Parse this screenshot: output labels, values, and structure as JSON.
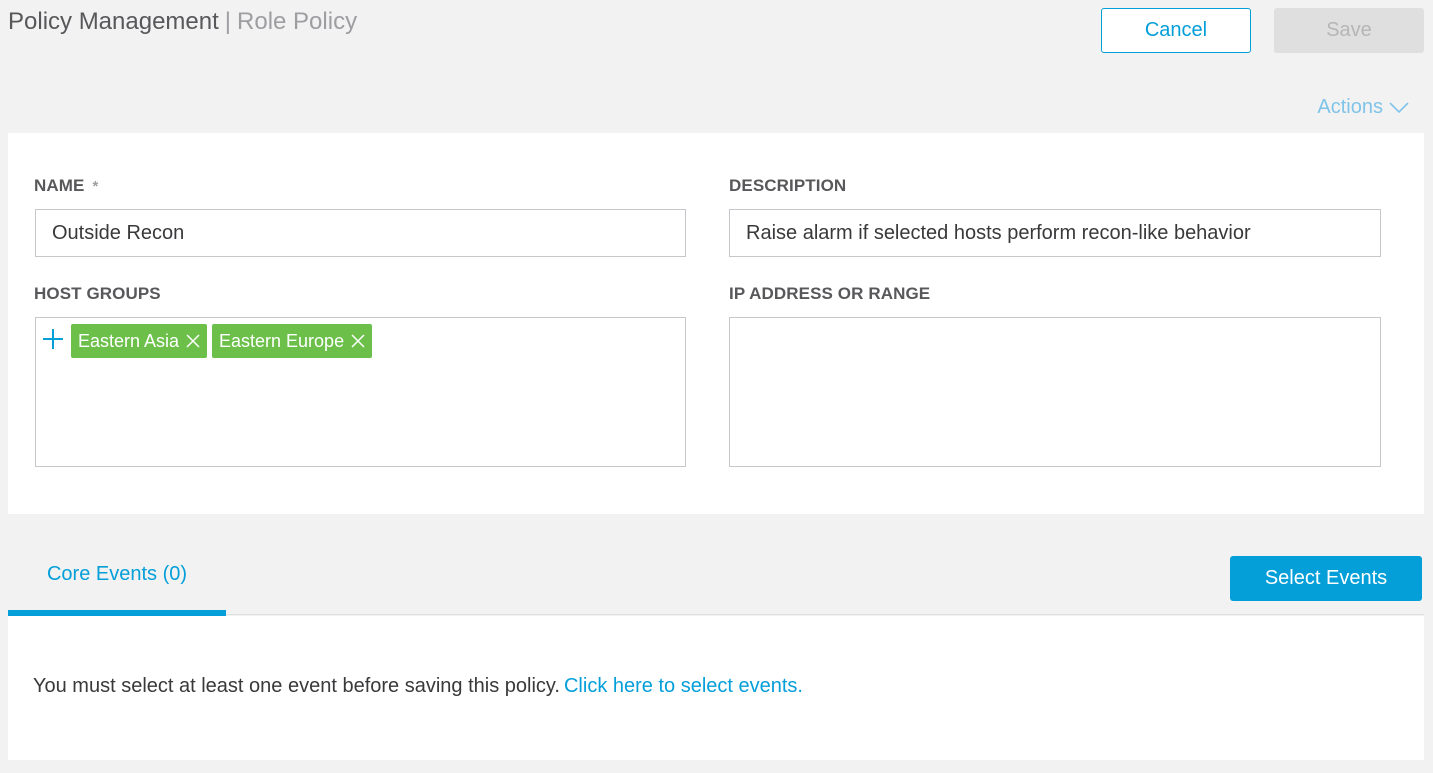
{
  "header": {
    "breadcrumb_main": "Policy Management",
    "breadcrumb_separator": "|",
    "breadcrumb_sub": "Role Policy",
    "cancel_label": "Cancel",
    "save_label": "Save",
    "actions_label": "Actions",
    "actions_icon": "chevron-down-icon"
  },
  "form": {
    "name_label": "NAME",
    "required_marker": "*",
    "name_value": "Outside Recon",
    "description_label": "DESCRIPTION",
    "description_value": "Raise alarm if selected hosts perform recon-like behavior",
    "host_groups_label": "HOST GROUPS",
    "host_groups_add_icon": "plus-icon",
    "host_groups": [
      {
        "label": "Eastern Asia",
        "remove_icon": "close-icon"
      },
      {
        "label": "Eastern Europe",
        "remove_icon": "close-icon"
      }
    ],
    "ip_label": "IP ADDRESS OR RANGE",
    "ip_value": ""
  },
  "events": {
    "tab_label": "Core Events (0)",
    "select_button_label": "Select Events",
    "message": "You must select at least one event before saving this policy.",
    "link_text": "Click here to select events."
  },
  "colors": {
    "accent": "#049fd9",
    "tag_green": "#6cc04a",
    "background": "#f2f2f2",
    "panel": "#ffffff",
    "disabled": "#dfdfdf"
  }
}
